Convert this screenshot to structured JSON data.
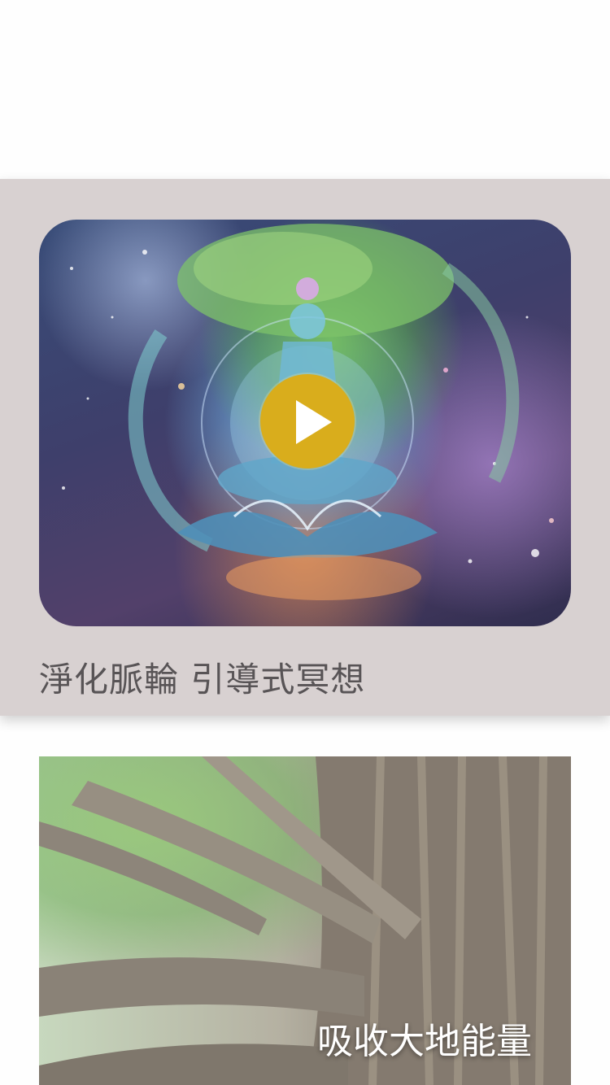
{
  "cards": [
    {
      "title": "淨化脈輪 引導式冥想",
      "media": "video-thumbnail",
      "play_icon": "play-icon",
      "accent": "#d9ad1c",
      "background": "#d8d1d1"
    },
    {
      "title": "吸收大地能量",
      "media": "image-thumbnail"
    }
  ]
}
